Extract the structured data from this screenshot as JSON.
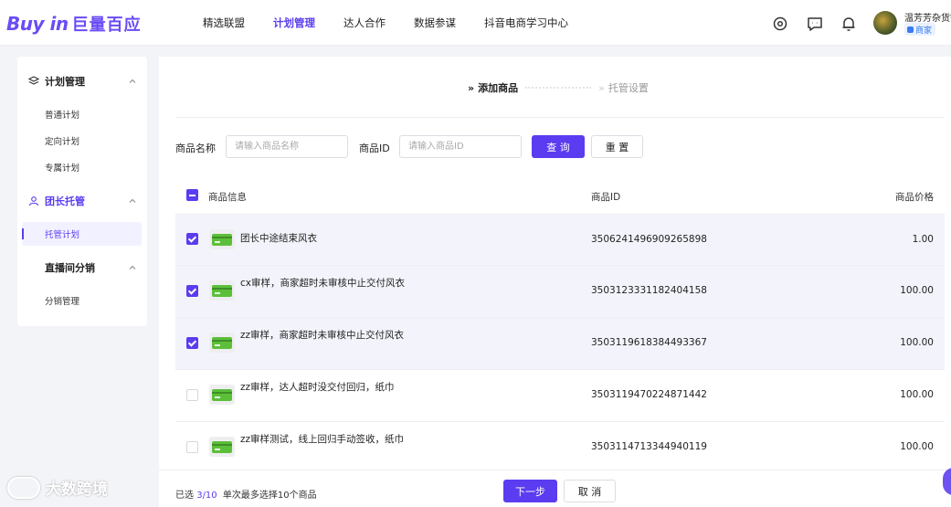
{
  "header": {
    "logo_en": "Buy in",
    "logo_cn": "巨量百应",
    "nav": [
      {
        "label": "精选联盟",
        "active": false
      },
      {
        "label": "计划管理",
        "active": true
      },
      {
        "label": "达人合作",
        "active": false
      },
      {
        "label": "数据参谋",
        "active": false
      },
      {
        "label": "抖音电商学习中心",
        "active": false
      }
    ],
    "user_name": "温芳芳杂货铺",
    "user_badge": "商家",
    "icons": [
      "settings-icon",
      "message-icon",
      "bell-icon"
    ]
  },
  "sidebar": {
    "groups": [
      {
        "label": "计划管理",
        "icon": "layers-icon",
        "items": [
          "普通计划",
          "定向计划",
          "专属计划"
        ]
      },
      {
        "label": "团长托管",
        "icon": "team-icon",
        "items": [
          "托管计划"
        ],
        "active_item": "托管计划"
      },
      {
        "label": "直播间分销",
        "icon": "",
        "items": [
          "分销管理"
        ]
      }
    ]
  },
  "steps": {
    "step1": "添加商品",
    "step2": "托管设置",
    "current": 1
  },
  "filters": {
    "name_label": "商品名称",
    "name_placeholder": "请输入商品名称",
    "id_label": "商品ID",
    "id_placeholder": "请输入商品ID",
    "query_label": "查 询",
    "reset_label": "重 置"
  },
  "table": {
    "columns": [
      "商品信息",
      "商品ID",
      "商品价格"
    ],
    "rows": [
      {
        "name": "团长中途结束风衣",
        "id": "3506241496909265898",
        "price": "1.00",
        "checked": true
      },
      {
        "name": "cx审样，商家超时未审核中止交付风衣",
        "id": "3503123331182404158",
        "price": "100.00",
        "checked": true
      },
      {
        "name": "zz审样，商家超时未审核中止交付风衣",
        "id": "3503119618384493367",
        "price": "100.00",
        "checked": true
      },
      {
        "name": "zz审样，达人超时没交付回归，纸巾",
        "id": "3503119470224871442",
        "price": "100.00",
        "checked": false
      },
      {
        "name": "zz审样测试，线上回归手动签收，纸巾",
        "id": "3503114713344940119",
        "price": "100.00",
        "checked": false
      }
    ]
  },
  "footer": {
    "selected_prefix": "已选",
    "selected_count": "3",
    "selected_total": "/10",
    "limit_text": "单次最多选择10个商品",
    "next_label": "下一步",
    "cancel_label": "取 消"
  },
  "watermark": "大数跨境",
  "colors": {
    "accent": "#5b3cf0",
    "selected_row": "#f3f4fb"
  }
}
